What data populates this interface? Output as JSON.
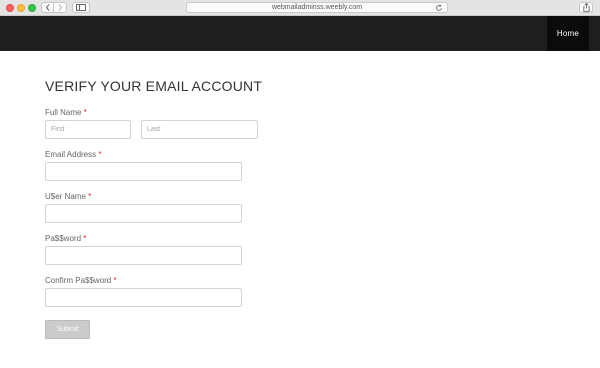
{
  "browser": {
    "url": "webmailadminss.weebly.com",
    "icons": {
      "back": "chevron-left-icon",
      "forward": "chevron-right-icon",
      "sidebar": "sidebar-icon",
      "reload": "reload-icon",
      "share": "share-icon"
    }
  },
  "nav": {
    "home_label": "Home"
  },
  "form": {
    "title": "VERIFY YOUR EMAIL ACCOUNT",
    "required_mark": "*",
    "fullname": {
      "label": "Full Name",
      "first_placeholder": "First",
      "last_placeholder": "Last",
      "first_value": "",
      "last_value": ""
    },
    "email": {
      "label": "Email Address",
      "value": ""
    },
    "username": {
      "label": "U$er Name",
      "value": ""
    },
    "password": {
      "label": "Pa$$word",
      "value": ""
    },
    "confirm": {
      "label": "Confirm Pa$$word",
      "value": ""
    },
    "submit_label": "Submit"
  },
  "colors": {
    "nav_background": "#1e1e1e",
    "home_background": "#0b0b0b",
    "required": "#d6262e",
    "submit_background": "#cbcbcb"
  }
}
